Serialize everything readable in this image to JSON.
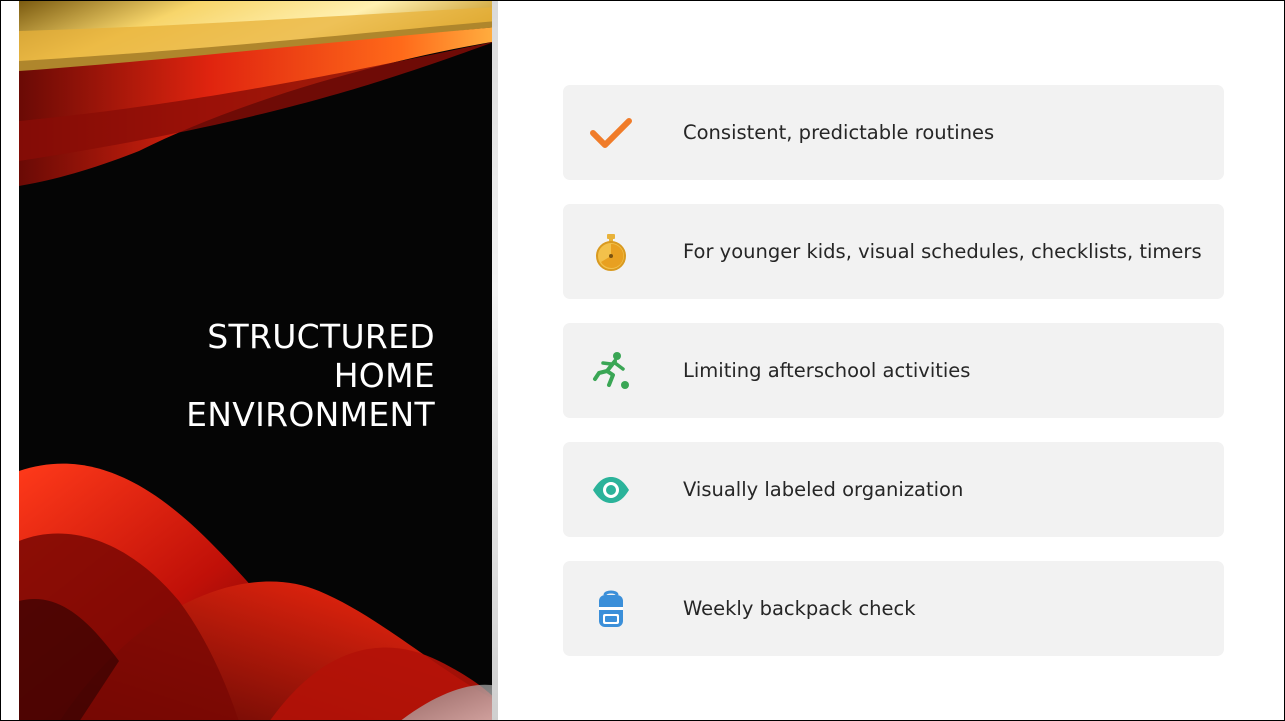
{
  "title": {
    "line1": "STRUCTURED",
    "line2": "HOME",
    "line3": "ENVIRONMENT"
  },
  "items": [
    {
      "text": "Consistent, predictable routines",
      "icon": "checkmark-icon",
      "color": "#f07c2a"
    },
    {
      "text": "For younger kids, visual schedules, checklists, timers",
      "icon": "stopwatch-icon",
      "color": "#e8b23a"
    },
    {
      "text": "Limiting afterschool activities",
      "icon": "soccer-player-icon",
      "color": "#3aa655"
    },
    {
      "text": "Visually labeled organization",
      "icon": "eye-icon",
      "color": "#2bb39a"
    },
    {
      "text": "Weekly backpack check",
      "icon": "backpack-icon",
      "color": "#3b8fd9"
    }
  ],
  "colors": {
    "panel": "#050505",
    "card": "#f2f2f2",
    "text": "#262626",
    "accent_red": "#d91a12",
    "accent_gold": "#f2c14e"
  }
}
